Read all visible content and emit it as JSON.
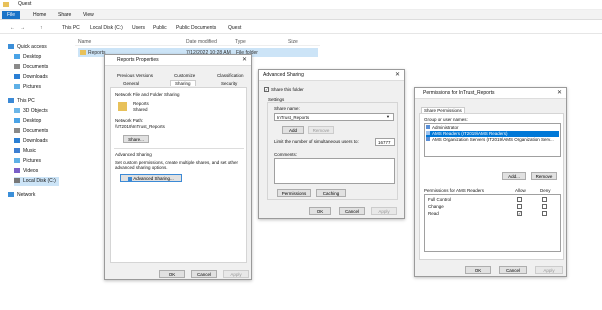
{
  "explorer": {
    "window_title": "Quest",
    "ribbon_tabs": [
      "File",
      "Home",
      "Share",
      "View"
    ],
    "breadcrumb": [
      "This PC",
      "Local Disk (C:)",
      "Users",
      "Public",
      "Public Documents",
      "Quest"
    ],
    "columns": {
      "name": "Name",
      "date": "Date modified",
      "type": "Type",
      "size": "Size"
    },
    "row": {
      "name": "Reports",
      "date": "7/12/2022 10:28 AM",
      "type": "File folder"
    },
    "nav": [
      "Quick access",
      "Desktop",
      "Documents",
      "Downloads",
      "Pictures",
      "This PC",
      "3D Objects",
      "Desktop",
      "Documents",
      "Downloads",
      "Music",
      "Pictures",
      "Videos",
      "Local Disk (C:)",
      "Network"
    ]
  },
  "props": {
    "title": "Reports Properties",
    "tabs_row1": [
      "Previous Versions",
      "Customize",
      "Classification"
    ],
    "tabs_row2": [
      "General",
      "Sharing",
      "Security"
    ],
    "section1": "Network File and Folder Sharing",
    "folder_name": "Reports",
    "folder_state": "Shared",
    "network_path_label": "Network Path:",
    "network_path": "\\\\IT2019\\InTrust_Reports",
    "share_btn": "Share...",
    "section2": "Advanced Sharing",
    "section2_desc": "Set custom permissions, create multiple shares, and set other advanced sharing options.",
    "adv_btn": "Advanced Sharing...",
    "ok": "OK",
    "cancel": "Cancel",
    "apply": "Apply"
  },
  "adv": {
    "title": "Advanced Sharing",
    "share_checkbox": "Share this folder",
    "settings": "Settings",
    "share_name_label": "Share name:",
    "share_name": "InTrust_Reports",
    "add": "Add",
    "remove": "Remove",
    "limit_label": "Limit the number of simultaneous users to:",
    "limit_value": "16777",
    "comments_label": "Comments:",
    "permissions": "Permissions",
    "caching": "Caching",
    "ok": "OK",
    "cancel": "Cancel",
    "apply": "Apply"
  },
  "perm": {
    "title": "Permissions for InTrust_Reports",
    "tab": "Share Permissions",
    "group_label": "Group or user names:",
    "users": [
      "Administrator",
      "AMS Readers (IT2019\\AMS Readers)",
      "AMS Organization Servers (IT2019\\AMS Organization Serv..."
    ],
    "add": "Add...",
    "remove": "Remove",
    "perm_label": "Permissions for AMS Readers",
    "allow": "Allow",
    "deny": "Deny",
    "rows": [
      {
        "name": "Full Control",
        "allow": false,
        "deny": false
      },
      {
        "name": "Change",
        "allow": false,
        "deny": false
      },
      {
        "name": "Read",
        "allow": true,
        "deny": false
      }
    ],
    "ok": "OK",
    "cancel": "Cancel",
    "apply": "Apply"
  }
}
